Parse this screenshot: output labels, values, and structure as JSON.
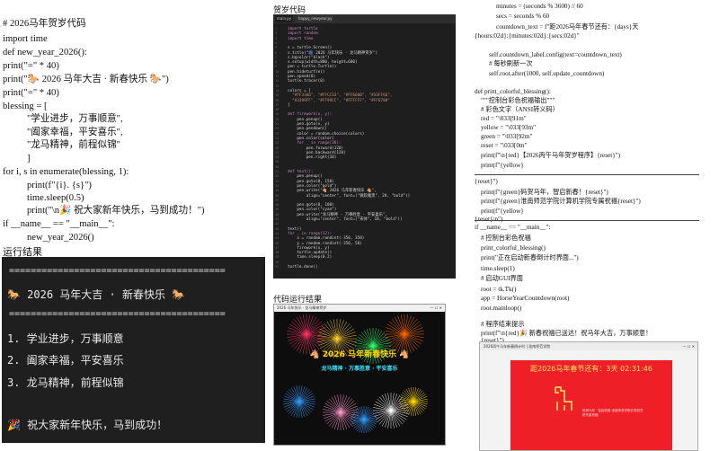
{
  "left": {
    "code": {
      "comment": "# 2026马年贺岁代码",
      "import": "import time",
      "def": "def new_year_2026():",
      "print_sep1": "print(\"=\" * 40)",
      "print_title": "print(\"🐎 2026 马年大吉 · 新春快乐 🐎\")",
      "print_sep2": "print(\"=\" * 40)",
      "blessing_open": "blessing = [",
      "b1": "\"学业进步，万事顺意\",",
      "b2": "\"阖家幸福，平安喜乐\",",
      "b3": "\"龙马精神，前程似锦\"",
      "blessing_close": "]",
      "for": "for i, s in enumerate(blessing, 1):",
      "print_item": "print(f\"{i}. {s}\")",
      "sleep": "time.sleep(0.5)",
      "print_final": "print(\"\\n🎉 祝大家新年快乐，马到成功！\")",
      "if_main": "if __name__ == \"__main__\":",
      "call": "new_year_2026()"
    },
    "run_title": "运行结果",
    "terminal": {
      "sep": "========================================",
      "title": "🐎 2026 马年大吉 · 新春快乐 🐎",
      "items": [
        "1. 学业进步，万事顺意",
        "2. 阖家幸福，平安喜乐",
        "3. 龙马精神，前程似锦"
      ],
      "final": "🎉 祝大家新年快乐，马到成功！"
    }
  },
  "middle": {
    "title": "贺岁代码",
    "tabs": [
      "main.py",
      "happy_newyear.py"
    ],
    "editor_lines": [
      "import turtle",
      "import random",
      "import time",
      "",
      "s = turtle.Screen()",
      "s.title(\"🎆 2026 马年快乐 · 龙马精神贺岁\")",
      "s.bgcolor(\"black\")",
      "s.setup(width=800, height=600)",
      "pen = turtle.Turtle()",
      "pen.hideturtle()",
      "pen.speed(0)",
      "turtle.tracer(0)",
      "",
      "colors = [",
      "  \"#FF3366\", \"#FFCC33\", \"#FF6600\", \"#33FF66\",",
      "  \"#3399FF\", \"#FF99CC\", \"#FFFFFF\", \"#FFD700\"",
      "]",
      "",
      "def firework(x, y):",
      "    pen.penup()",
      "    pen.goto(x, y)",
      "    pen.pendown()",
      "    color = random.choice(colors)",
      "    pen.color(color)",
      "    for _ in range(36):",
      "        pen.forward(120)",
      "        pen.backward(120)",
      "        pen.right(10)",
      "",
      "",
      "def text():",
      "    pen.penup()",
      "    pen.goto(0, 150)",
      "    pen.color(\"gold\")",
      "    pen.write(\"🐴 2026 马年新春快乐 🐴\",",
      "        align=\"center\", font=(\"微软雅黑\", 28, \"bold\"))",
      "",
      "    pen.goto(0, 100)",
      "    pen.color(\"cyan\")",
      "    pen.write(\"龙马精神 · 万事胜意 · 平安喜乐\",",
      "        align=\"center\", font=(\"宋体\", 18, \"bold\"))",
      "",
      "text()",
      "for _ in range(12):",
      "    x = random.randint(-350, 350)",
      "    y = random.randint(-250, 50)",
      "    firework(x, y)",
      "    turtle.update()",
      "    time.sleep(0.2)",
      "",
      "turtle.done()"
    ],
    "result_title": "代码运行结果",
    "window_title": "2026 马年快乐 · 龙马精神贺岁",
    "fw_text1": "🐴 2026 马年新春快乐 🐴",
    "fw_text2": "龙马精神 · 万事胜意 · 平安喜乐",
    "colors": {
      "gold": "#FFD700",
      "cyan": "#33E6FF"
    }
  },
  "right": {
    "lines": [
      "minutes = (seconds % 3600) // 60",
      "secs = seconds % 60",
      "countdown_text = f\"距2026马年春节还有：{days}天",
      "{hours:02d}:{minutes:02d}:{secs:02d}\"",
      "",
      "self.countdown_label.config(text=countdown_text)",
      "# 每秒刷新一次",
      "self.root.after(1000, self.update_countdown)",
      "",
      "def print_colorful_blessing():",
      "\"\"\"控制台彩色祝福输出\"\"\"",
      "# 彩色文字（ANSI转义码）",
      "red = \"\\033[91m\"",
      "yellow = \"\\033[93m\"",
      "green = \"\\033[92m\"",
      "reset = \"\\033[0m\"",
      "print(f\"\\n{red}【2026丙午马年贺岁程序】{reset}\")",
      "print(f\"{yellow}",
      "",
      "{reset}\")",
      "print(f\"{green}码贺马年，智启新春！{reset}\")",
      "print(f\"{green}淮南师范学院计算机学院专属祝福{reset}\")",
      "print(f\"{yellow}",
      "",
      "{reset}\\n\")",
      "if __name__ == \"__main__\":",
      "# 控制台彩色祝福",
      "print_colorful_blessing()",
      "print(\"正在启动新春倒计时界面...\")",
      "time.sleep(1)",
      "# 启动GUI界面",
      "root = tk.Tk()",
      "app = HorseYearCountdown(root)",
      "root.mainloop()",
      "",
      "# 程序结束提示",
      "print(f\"\\n{red}🎉 新春祝福已送达！祝马年大吉，万事顺意！",
      "{reset}\")"
    ],
    "window_title": "2026丙午马年新春倒计时 | 淮南师范学院",
    "countdown": "距2026马年春节还有：3天 02:31:46",
    "sub": "码贺马年 · 智启新春\n淮南师范学院计算机学院专属祝福",
    "red": "#EE1F26"
  }
}
